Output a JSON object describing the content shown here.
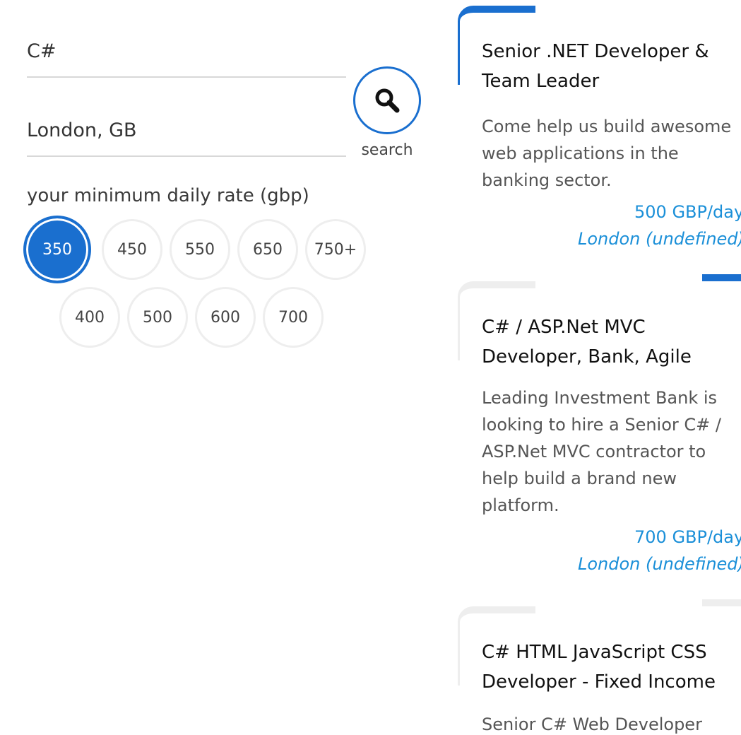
{
  "search": {
    "keyword_value": "C#",
    "location_value": "London, GB",
    "button_label": "search",
    "rate_label": "your minimum daily rate (gbp)",
    "rates_row1": [
      "350",
      "450",
      "550",
      "650",
      "750+"
    ],
    "rates_row2": [
      "400",
      "500",
      "600",
      "700"
    ],
    "selected_rate": "350"
  },
  "jobs": [
    {
      "title_line1": "Senior .NET Developer &",
      "title_line2": "Team Leader",
      "desc_lines": [
        "Come help us build awesome",
        "web applications in the",
        "banking sector."
      ],
      "rate": "500 GBP/day",
      "location": "London (undefined)"
    },
    {
      "title_line1": "C# / ASP.Net MVC",
      "title_line2": "Developer, Bank, Agile",
      "desc_lines": [
        "Leading Investment Bank is",
        "looking to hire a Senior C# /",
        "ASP.Net MVC contractor to",
        "help build a brand new",
        "platform."
      ],
      "rate": "700 GBP/day",
      "location": "London (undefined)"
    },
    {
      "title_line1": "C# HTML JavaScript CSS",
      "title_line2": "Developer - Fixed Income",
      "desc_lines": [
        "Senior C# Web Developer"
      ]
    }
  ],
  "colors": {
    "accent": "#1a6fcf",
    "link": "#1a8fd8",
    "muted_border": "#eeeeee"
  }
}
